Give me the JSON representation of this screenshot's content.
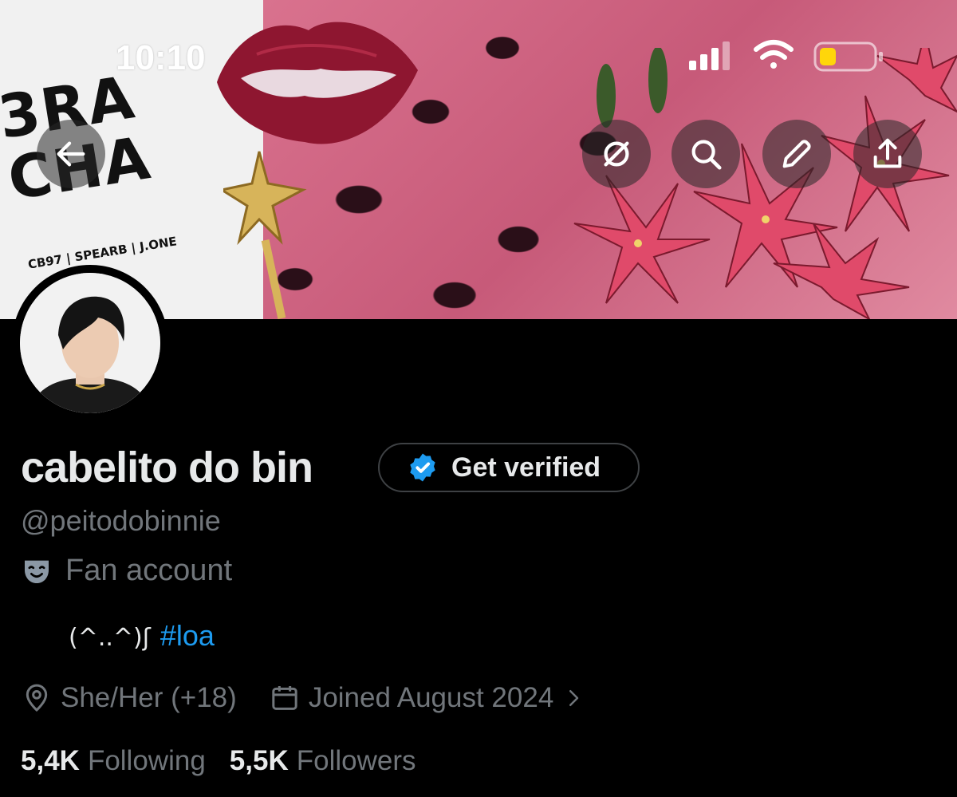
{
  "status_bar": {
    "time": "10:10"
  },
  "banner": {
    "poster_title_line1": "3RA",
    "poster_title_line2": "CHA",
    "poster_members": "CB97 | SPEARB | J.ONE"
  },
  "toolbar": {
    "back_icon": "arrow-left-icon",
    "buttons": [
      "grok-icon",
      "search-icon",
      "pencil-icon",
      "share-icon"
    ]
  },
  "profile": {
    "name": "cabelito do bin",
    "verify_label": "Get verified",
    "handle": "@peitodobinnie",
    "category": "Fan account",
    "bio_kaomoji": "(^..^)ʃ",
    "bio_hashtag": "#loa",
    "location": "She/Her (+18)",
    "joined": "Joined August 2024",
    "following_count": "5,4K",
    "following_label": "Following",
    "followers_count": "5,5K",
    "followers_label": "Followers"
  },
  "colors": {
    "background": "#000000",
    "text_primary": "#e7e9ea",
    "text_secondary": "#71767b",
    "accent": "#1d9bf0"
  }
}
